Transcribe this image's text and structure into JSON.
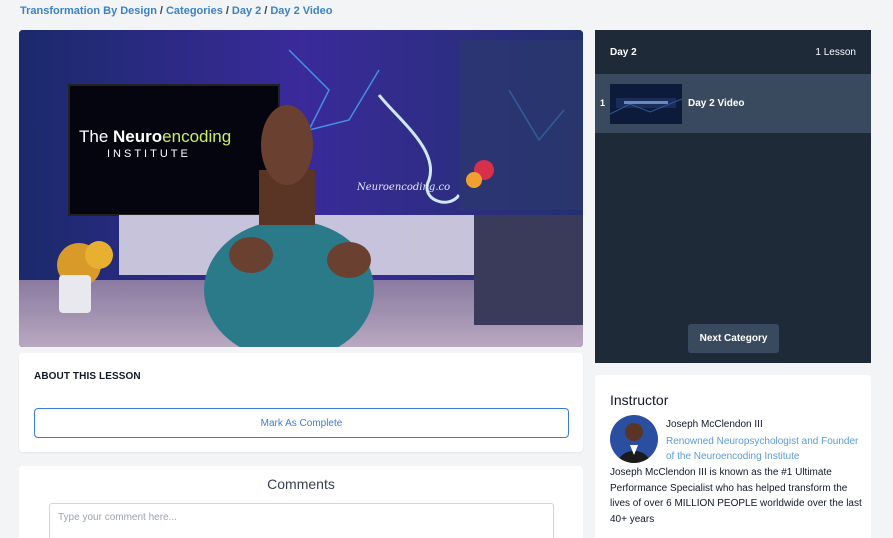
{
  "breadcrumb": {
    "items": [
      "Transformation By Design",
      "Categories",
      "Day 2",
      "Day 2 Video"
    ],
    "separator": "/"
  },
  "video": {
    "sign_line1_a": "The ",
    "sign_line1_b": "Neuro",
    "sign_line1_c": "encoding",
    "sign_line2": "INSTITUTE",
    "neon_text": "Neuroencoding.co"
  },
  "about": {
    "title": "ABOUT THIS LESSON",
    "mark_complete": "Mark As Complete"
  },
  "comments": {
    "title": "Comments",
    "placeholder": "Type your comment here..."
  },
  "lessons": {
    "category": "Day 2",
    "count": "1 Lesson",
    "items": [
      {
        "number": "1",
        "label": "Day 2 Video"
      }
    ],
    "next_button": "Next Category"
  },
  "instructor": {
    "heading": "Instructor",
    "name": "Joseph McClendon III",
    "role": "Renowned Neuropsychologist and Founder of the Neuroencoding Institute",
    "bio": "Joseph McClendon III is known as the #1 Ultimate Performance Specialist who has helped transform the lives of over 6 MILLION PEOPLE worldwide over the last 40+ years"
  },
  "colors": {
    "link": "#3b82c4",
    "sidebar_bg": "#1e2a38",
    "sidebar_active": "#3a4a5e",
    "accent_button": "#3b7dd8"
  }
}
